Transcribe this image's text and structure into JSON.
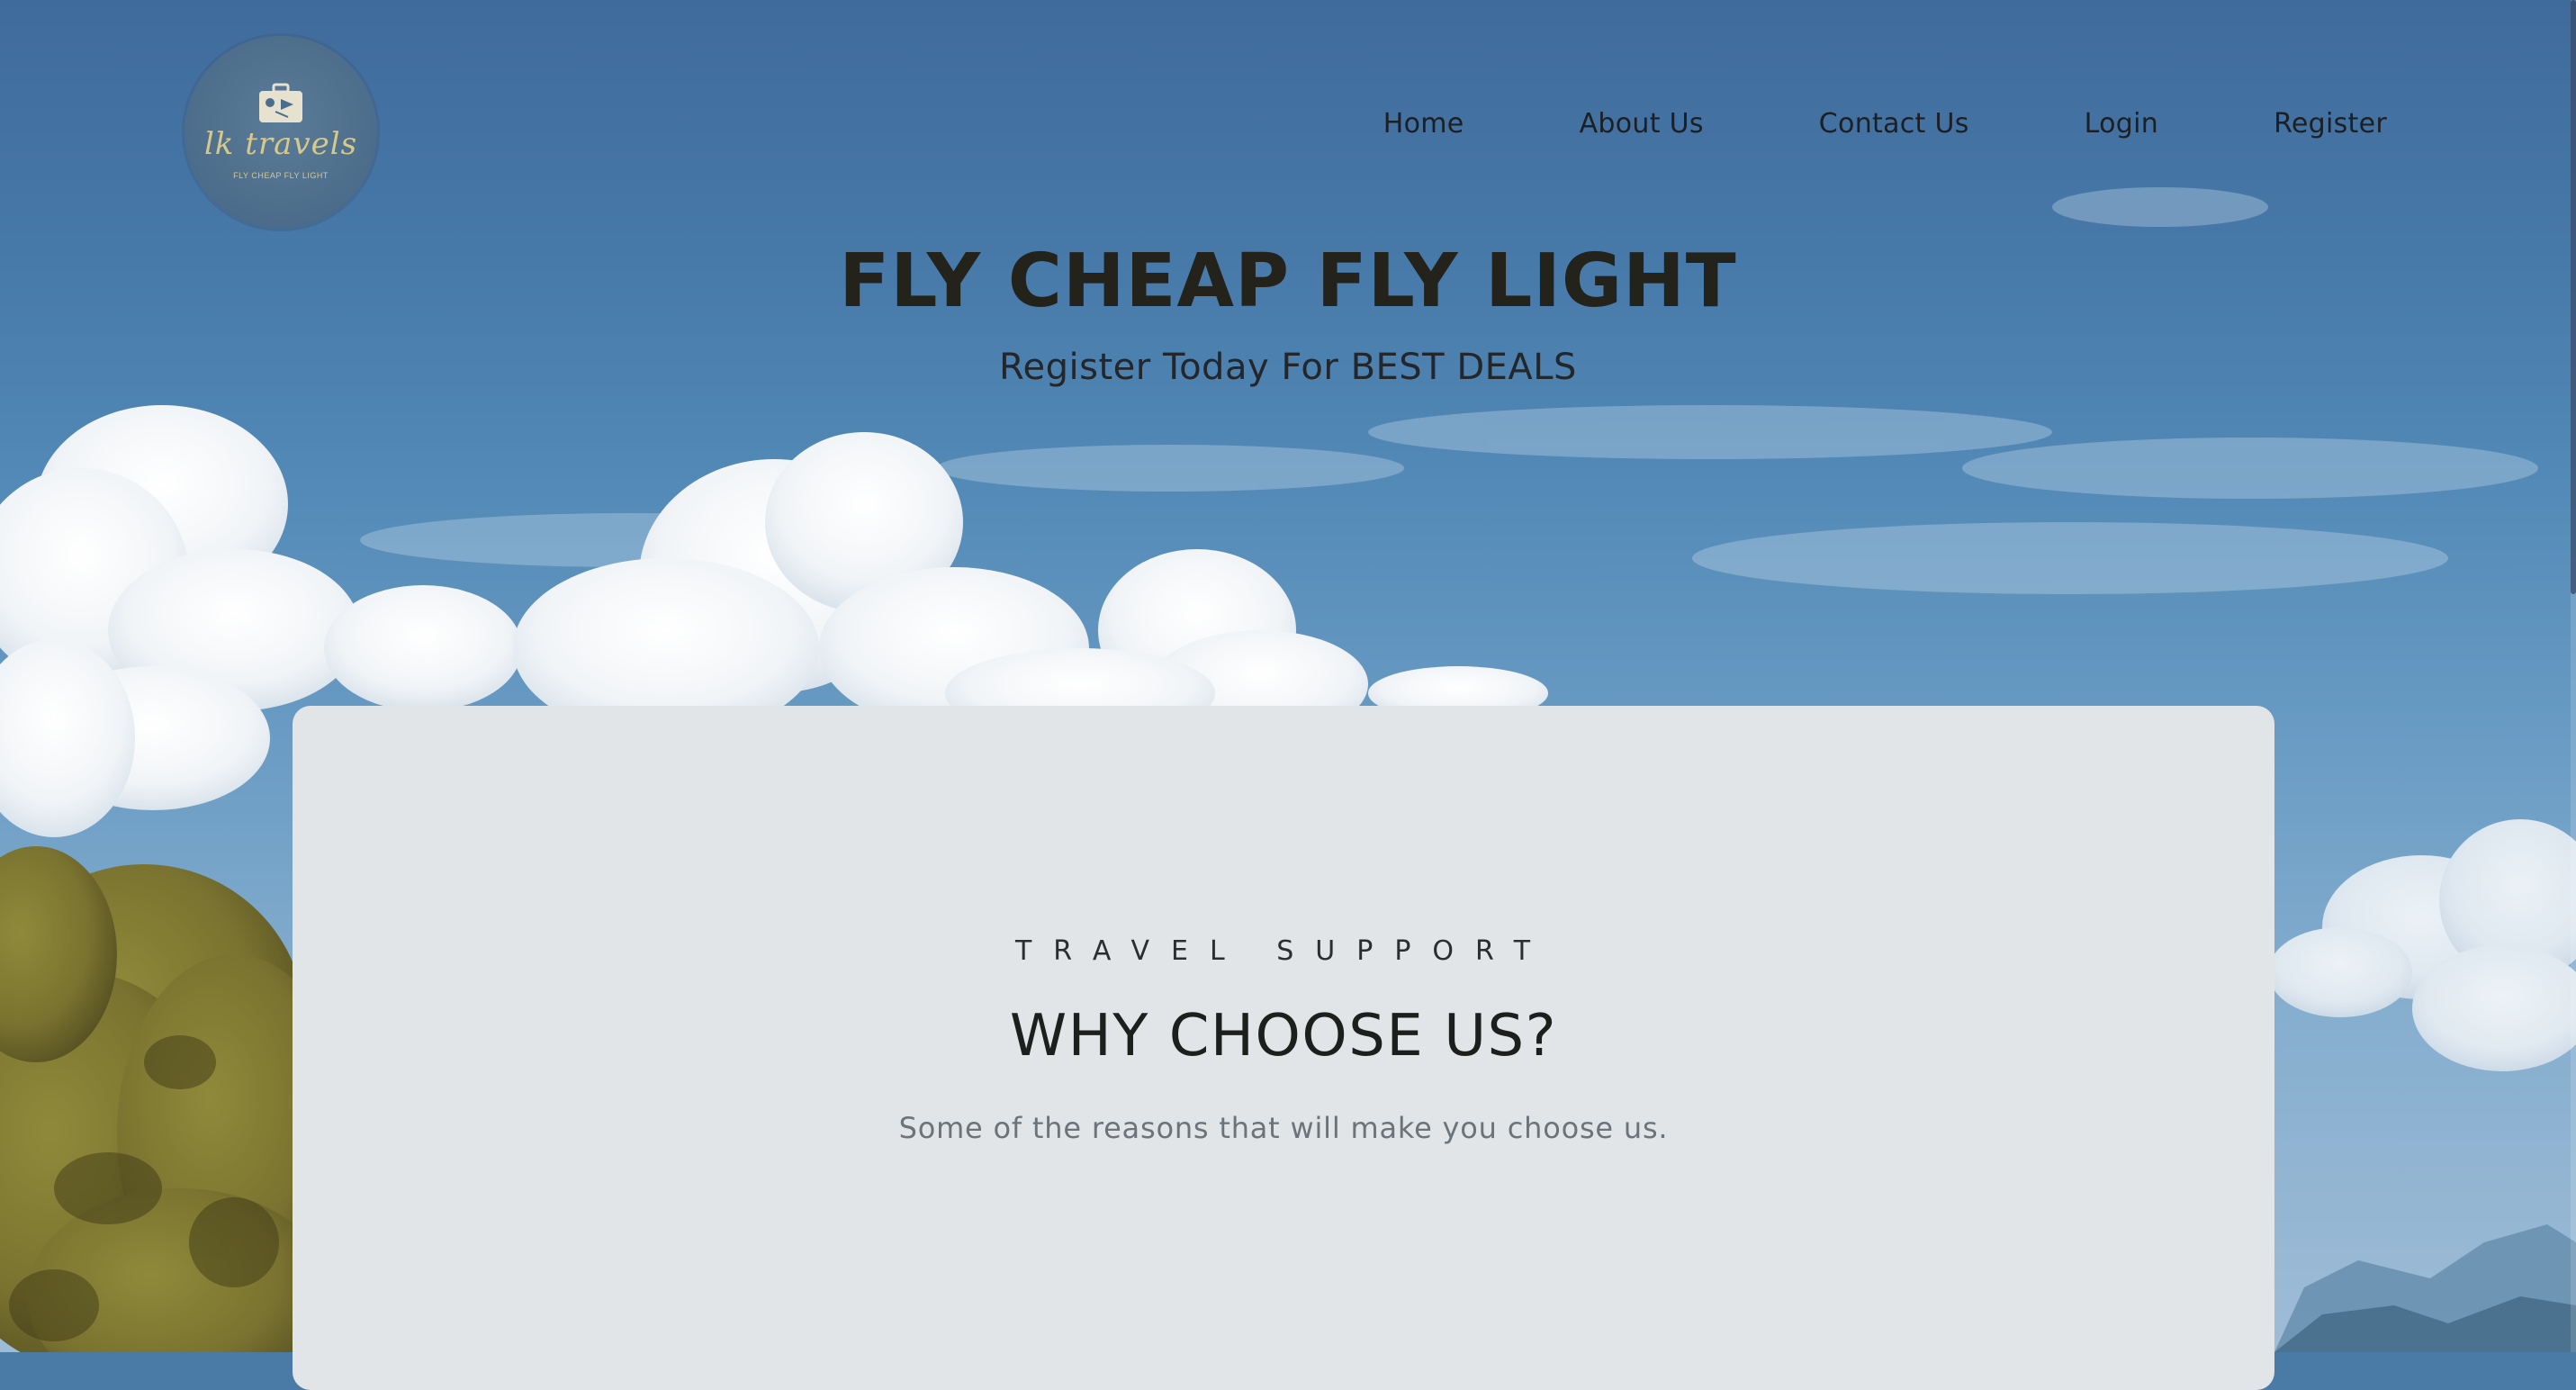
{
  "brand": {
    "logo_text": "lk travels",
    "logo_tagline": "FLY CHEAP FLY LIGHT",
    "logo_icon": "suitcase-icon",
    "logo_color": "#d7c98a"
  },
  "nav": {
    "items": [
      {
        "label": "Home"
      },
      {
        "label": "About Us"
      },
      {
        "label": "Contact Us"
      },
      {
        "label": "Login"
      },
      {
        "label": "Register"
      }
    ]
  },
  "hero": {
    "title": "FLY CHEAP FLY LIGHT",
    "subtitle": "Register Today For BEST DEALS"
  },
  "section": {
    "kicker": "TRAVEL SUPPORT",
    "title": "WHY CHOOSE US?",
    "description": "Some of the reasons that will make you choose us."
  },
  "colors": {
    "sky": "#4a7aa6",
    "card": "#e2e5e8",
    "text_dark": "#1d1f1c",
    "text_muted": "#6c7479"
  }
}
